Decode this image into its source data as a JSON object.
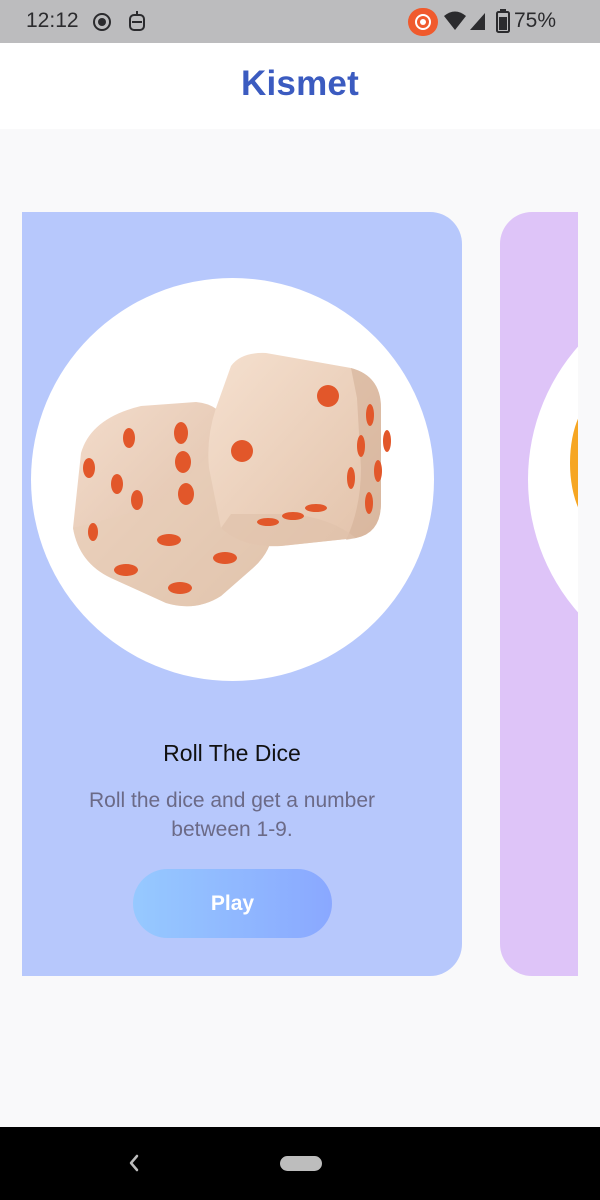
{
  "status_bar": {
    "time": "12:12",
    "battery": "75%",
    "icons": [
      "radio-icon",
      "robot-icon",
      "record-icon",
      "wifi-icon",
      "signal-icon",
      "battery-icon"
    ]
  },
  "app": {
    "title": "Kismet",
    "title_color": "#3b5bc0"
  },
  "cards": [
    {
      "image": "dice-image",
      "title": "Roll The Dice",
      "description": "Roll the dice and get a number between 1-9.",
      "button_label": "Play",
      "background": "#b7c8fc"
    },
    {
      "image": "partial-next-card-image",
      "background": "#dec4f8"
    }
  ],
  "nav_bar": {
    "icons": [
      "back-icon",
      "home-pill-icon"
    ]
  }
}
